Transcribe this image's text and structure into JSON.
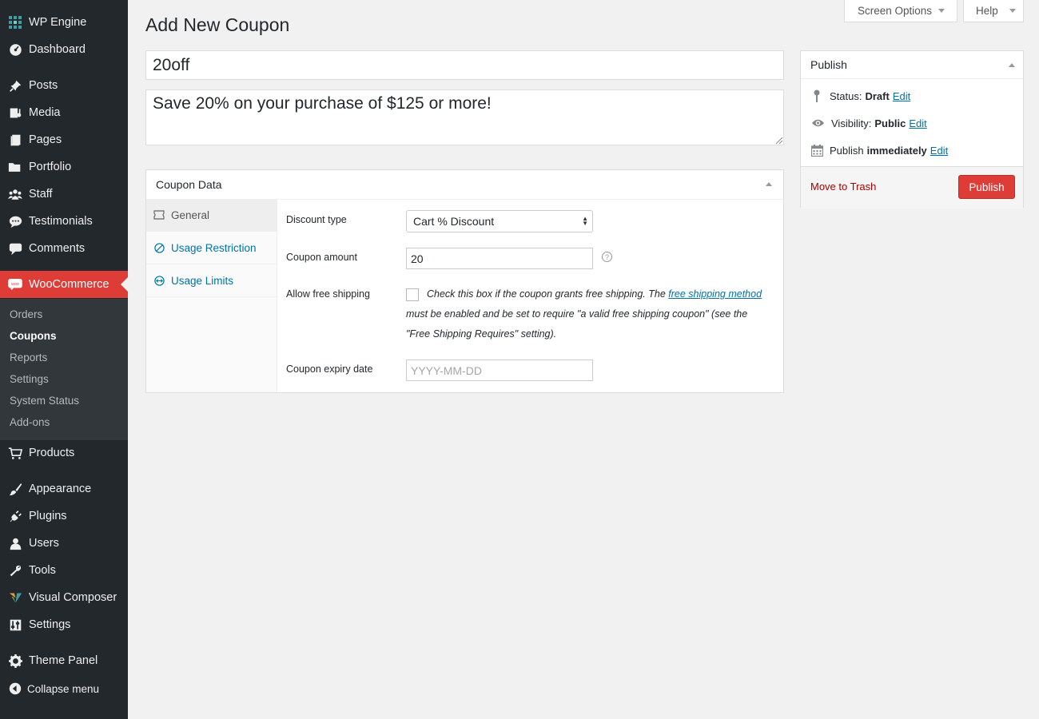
{
  "sidebar": {
    "items": [
      {
        "label": "WP Engine",
        "icon": "wp-engine-icon"
      },
      {
        "label": "Dashboard",
        "icon": "dashboard-icon"
      },
      {
        "label": "Posts",
        "icon": "pin-icon"
      },
      {
        "label": "Media",
        "icon": "media-icon"
      },
      {
        "label": "Pages",
        "icon": "pages-icon"
      },
      {
        "label": "Portfolio",
        "icon": "folder-icon"
      },
      {
        "label": "Staff",
        "icon": "groups-icon"
      },
      {
        "label": "Testimonials",
        "icon": "speech-bubble-icon"
      },
      {
        "label": "Comments",
        "icon": "comment-icon"
      },
      {
        "label": "WooCommerce",
        "icon": "woo-icon"
      },
      {
        "label": "Products",
        "icon": "cart-icon"
      },
      {
        "label": "Appearance",
        "icon": "brush-icon"
      },
      {
        "label": "Plugins",
        "icon": "plug-icon"
      },
      {
        "label": "Users",
        "icon": "user-icon"
      },
      {
        "label": "Tools",
        "icon": "wrench-icon"
      },
      {
        "label": "Visual Composer",
        "icon": "visual-composer-icon"
      },
      {
        "label": "Settings",
        "icon": "settings-sliders-icon"
      },
      {
        "label": "Theme Panel",
        "icon": "gear-icon"
      },
      {
        "label": "Collapse menu",
        "icon": "collapse-icon"
      }
    ],
    "submenu": [
      "Orders",
      "Coupons",
      "Reports",
      "Settings",
      "System Status",
      "Add-ons"
    ],
    "active_submenu": "Coupons"
  },
  "screen_options": {
    "label": "Screen Options"
  },
  "help": {
    "label": "Help"
  },
  "page_title": "Add New Coupon",
  "coupon_code": "20off",
  "coupon_description": "Save 20% on your purchase of $125 or more!",
  "coupon_data": {
    "title": "Coupon Data",
    "tabs": [
      "General",
      "Usage Restriction",
      "Usage Limits"
    ],
    "fields": {
      "discount_type_label": "Discount type",
      "discount_type_value": "Cart % Discount",
      "amount_label": "Coupon amount",
      "amount_value": "20",
      "free_shipping_label": "Allow free shipping",
      "free_shipping_text_1": "Check this box if the coupon grants free shipping. The",
      "free_shipping_link": "free shipping method",
      "free_shipping_text_2": "must be enabled and be set to require \"a valid free shipping coupon\" (see the",
      "free_shipping_text_3": "\"Free Shipping Requires\" setting).",
      "expiry_label": "Coupon expiry date",
      "expiry_placeholder": "YYYY-MM-DD"
    }
  },
  "publish": {
    "title": "Publish",
    "status_label": "Status:",
    "status_value": "Draft",
    "visibility_label": "Visibility:",
    "visibility_value": "Public",
    "schedule_label": "Publish",
    "schedule_value": "immediately",
    "edit_label": "Edit",
    "trash_label": "Move to Trash",
    "publish_button": "Publish"
  },
  "colors": {
    "sidebar_bg": "#23282d",
    "submenu_bg": "#32373c",
    "accent": "#dd3d36",
    "link": "#0073aa",
    "trash": "#a00"
  }
}
